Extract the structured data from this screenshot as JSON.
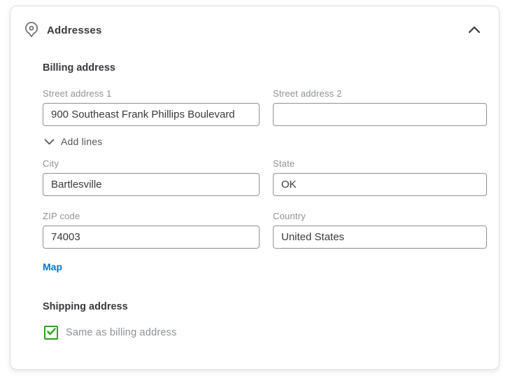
{
  "header": {
    "title": "Addresses",
    "pin_icon": "location-pin",
    "collapse_icon": "chevron-up"
  },
  "billing": {
    "heading": "Billing address",
    "street1": {
      "label": "Street address 1",
      "value": "900 Southeast Frank Phillips Boulevard"
    },
    "street2": {
      "label": "Street address 2",
      "value": ""
    },
    "add_lines_label": "Add lines",
    "city": {
      "label": "City",
      "value": "Bartlesville"
    },
    "state": {
      "label": "State",
      "value": "OK"
    },
    "zip": {
      "label": "ZIP code",
      "value": "74003"
    },
    "country": {
      "label": "Country",
      "value": "United States"
    },
    "map_link_label": "Map"
  },
  "shipping": {
    "heading": "Shipping address",
    "same_as_billing": {
      "label": "Same as billing address",
      "checked": true
    }
  },
  "colors": {
    "accent_green": "#2ca01c",
    "link_blue": "#0077c5",
    "text_dark": "#393a3d",
    "text_gray": "#8d9096",
    "card_border": "#dcdee0"
  }
}
